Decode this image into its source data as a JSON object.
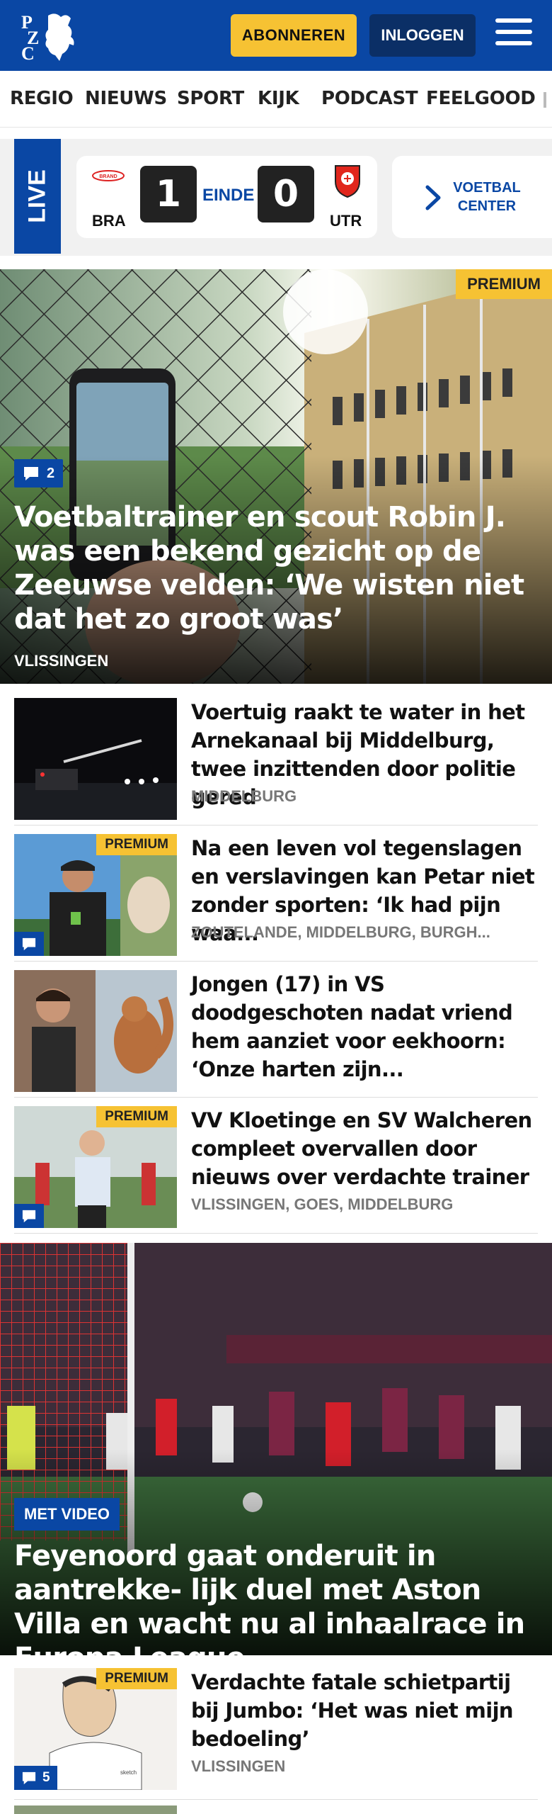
{
  "header": {
    "logo_text": "PZC",
    "subscribe_label": "ABONNEREN",
    "login_label": "INLOGGEN",
    "brand_color": "#0a47a4",
    "accent_color": "#f6c233"
  },
  "nav": {
    "items": [
      "REGIO",
      "NIEUWS",
      "SPORT",
      "KIJK",
      "PODCAST",
      "FEELGOOD"
    ]
  },
  "live": {
    "label": "LIVE",
    "home_team": "BRA",
    "home_score": "1",
    "status": "EINDE",
    "away_score": "0",
    "away_team": "UTR",
    "center_label_line1": "VOETBAL",
    "center_label_line2": "CENTER"
  },
  "hero": {
    "badge": "PREMIUM",
    "comments": "2",
    "title": "Voetbaltrainer en scout Robin J. was een bekend gezicht op de Zeeuwse velden: ‘We wisten niet dat het zo groot was’",
    "place": "VLISSINGEN"
  },
  "articles": [
    {
      "title": "Voertuig raakt te water in het Arnekanaal bij Middelburg, twee inzittenden door politie gered",
      "place": "MIDDELBURG",
      "premium": "",
      "comments": ""
    },
    {
      "title": "Na een leven vol tegenslagen en verslavingen kan Petar niet zonder sporten: ‘Ik had pijn waa...",
      "place": "ZOUTELANDE, MIDDELBURG, BURGH...",
      "premium": "PREMIUM",
      "comments": ""
    },
    {
      "title": "Jongen (17) in VS doodgeschoten nadat vriend hem aanziet voor eekhoorn: ‘Onze harten zijn...",
      "place": "",
      "premium": "",
      "comments": ""
    },
    {
      "title": "VV Kloetinge en SV Walcheren compleet overvallen door nieuws over verdachte trainer",
      "place": "VLISSINGEN, GOES, MIDDELBURG",
      "premium": "PREMIUM",
      "comments": ""
    }
  ],
  "hero2": {
    "video_label": "MET VIDEO",
    "title": "Feyenoord gaat onderuit in aantrekke- lijk duel met Aston Villa en wacht nu al inhaalrace in Europa League"
  },
  "article_last": {
    "title": "Verdachte fatale schietpartij bij Jumbo: ‘Het was niet mijn bedoeling’",
    "place": "VLISSINGEN",
    "premium": "PREMIUM",
    "comments": "5"
  }
}
